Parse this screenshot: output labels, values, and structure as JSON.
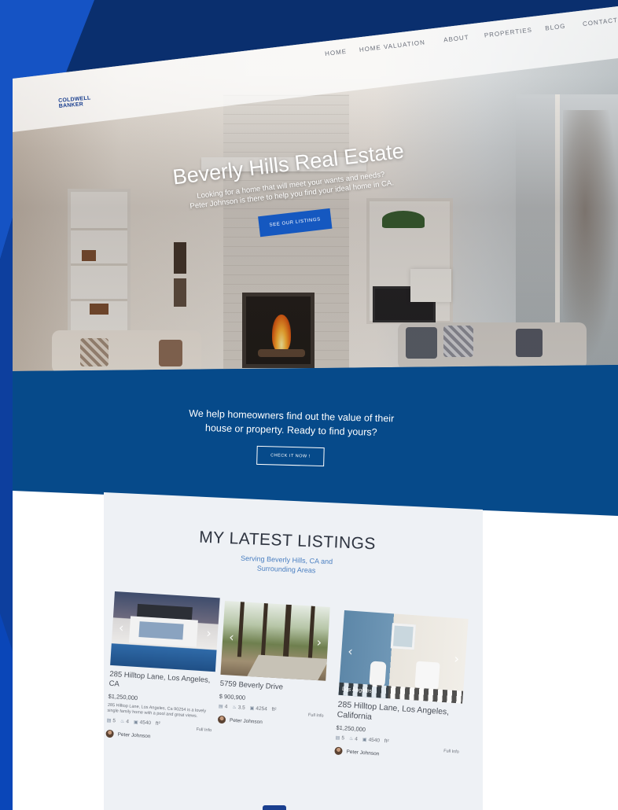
{
  "logo": {
    "line1": "COLDWELL",
    "line2": "BANKER"
  },
  "nav": {
    "items": [
      "HOME",
      "HOME VALUATION",
      "ABOUT",
      "PROPERTIES",
      "BLOG",
      "CONTACT"
    ]
  },
  "hero": {
    "title": "Beverly Hills Real Estate",
    "subtitle_line1": "Looking for a home that will meet your wants and needs?",
    "subtitle_line2": "Peter Johnson is there to help you find your ideal home in CA.",
    "button": "SEE OUR LISTINGS"
  },
  "valuation": {
    "line1": "We help homeowners find out the value of their",
    "line2": "house or property. Ready to find yours?",
    "button": "CHECK IT NOW !"
  },
  "listings": {
    "title": "MY LATEST LISTINGS",
    "subtitle_line1": "Serving Beverly Hills, CA and",
    "subtitle_line2": "Surrounding Areas",
    "cards": [
      {
        "address": "285 Hilltop Lane, Los Angeles, CA",
        "price": "$1,250,000",
        "description": "285 Hilltop Lane, Los Angeles, Ca 90254 is a lovely single family home with a pool and great views.",
        "beds": "5",
        "baths": "4",
        "sqft": "4540",
        "sqft_unit": "ft²",
        "full_info": "Full Info",
        "agent": "Peter Johnson",
        "tag": "",
        "count": ""
      },
      {
        "address": "5759 Beverly Drive",
        "price": "$ 900,900",
        "description": "",
        "beds": "4",
        "baths": "3.5",
        "sqft": "4254",
        "sqft_unit": "ft²",
        "full_info": "Full Info",
        "agent": "Peter Johnson",
        "tag": "",
        "count": ""
      },
      {
        "address": "285 Hilltop Lane, Los Angeles, California",
        "price": "$1,250,000",
        "description": "",
        "beds": "5",
        "baths": "4",
        "sqft": "4540",
        "sqft_unit": "ft²",
        "full_info": "Full Info",
        "agent": "Peter Johnson",
        "tag": "Los Angeles",
        "count": "5"
      }
    ]
  },
  "icons": {
    "prev": "chevron-left-icon",
    "next": "chevron-right-icon",
    "bed": "bed-icon",
    "bath": "bath-icon",
    "area": "area-icon"
  },
  "colors": {
    "brand_blue": "#1558c0",
    "band_blue": "#064a8a",
    "page_bg": "#0a2f6e"
  }
}
